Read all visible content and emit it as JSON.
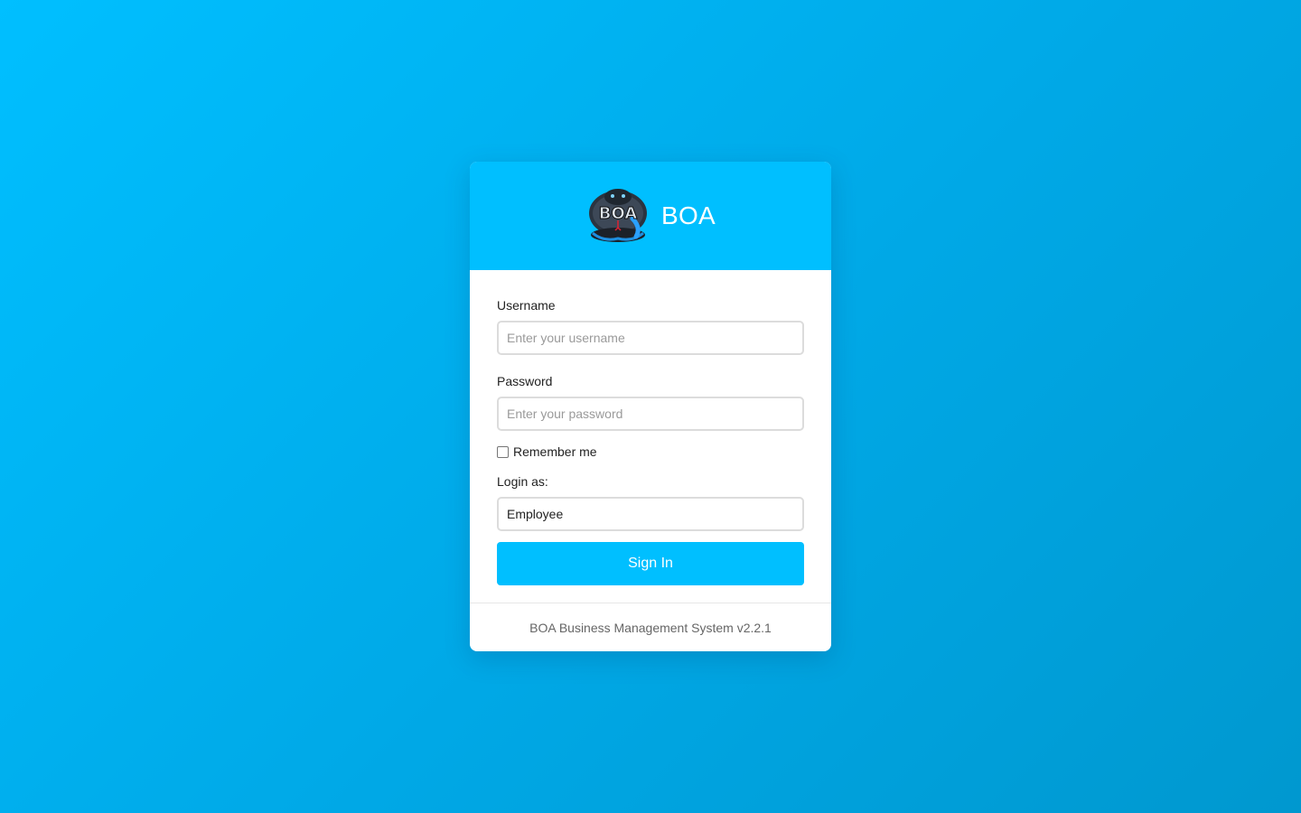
{
  "header": {
    "brand": "BOA",
    "logo_icon": "cobra-logo-icon",
    "logo_text": "BOA"
  },
  "form": {
    "username_label": "Username",
    "username_placeholder": "Enter your username",
    "username_value": "",
    "password_label": "Password",
    "password_placeholder": "Enter your password",
    "password_value": "",
    "remember_label": "Remember me",
    "remember_checked": false,
    "login_as_label": "Login as:",
    "login_as_value": "Employee",
    "submit_label": "Sign In"
  },
  "footer": {
    "text": "BOA Business Management System v2.2.1"
  },
  "colors": {
    "accent": "#00bfff",
    "background_start": "#00bfff",
    "background_end": "#0098cf"
  }
}
